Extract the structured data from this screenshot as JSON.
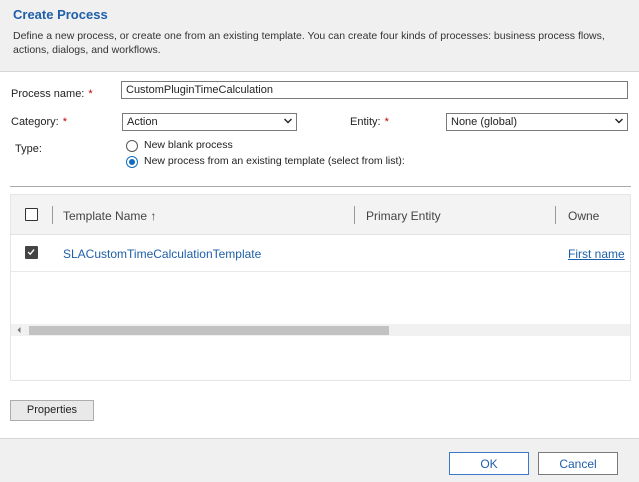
{
  "header": {
    "title": "Create Process",
    "description": "Define a new process, or create one from an existing template. You can create four kinds of processes: business process flows, actions, dialogs, and workflows."
  },
  "form": {
    "process_name_label": "Process name:",
    "process_name_value": "CustomPluginTimeCalculation",
    "category_label": "Category:",
    "category_value": "Action",
    "entity_label": "Entity:",
    "entity_value": "None (global)",
    "type_label": "Type:",
    "required_marker": "*",
    "type_options": [
      {
        "label": "New blank process",
        "selected": false
      },
      {
        "label": "New process from an existing template (select from list):",
        "selected": true
      }
    ]
  },
  "grid": {
    "columns": [
      "Template Name",
      "Primary Entity",
      "Owne"
    ],
    "sort_indicator": "↑",
    "rows": [
      {
        "checked": true,
        "template_name": "SLACustomTimeCalculationTemplate",
        "primary_entity": "",
        "owner": "First name"
      }
    ]
  },
  "buttons": {
    "properties": "Properties",
    "ok": "OK",
    "cancel": "Cancel"
  },
  "colors": {
    "accent": "#1f5fa8",
    "required": "#c00000",
    "radio_selected": "#0f6cbd"
  }
}
